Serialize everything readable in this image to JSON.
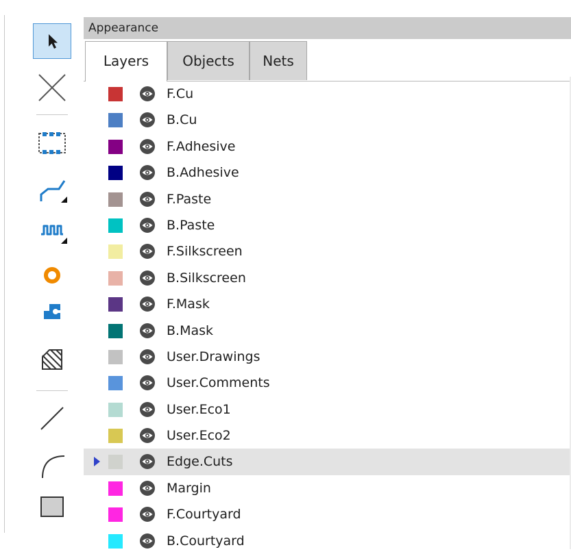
{
  "panel": {
    "title": "Appearance",
    "tabs": [
      {
        "label": "Layers",
        "active": true
      },
      {
        "label": "Objects",
        "active": false
      },
      {
        "label": "Nets",
        "active": false
      }
    ]
  },
  "toolbar": {
    "tools": [
      {
        "name": "select-tool",
        "icon": "cursor-arrow-icon",
        "active": true
      },
      {
        "name": "local-ratsnest-tool",
        "icon": "ratsnest-x-icon"
      },
      {
        "name": "add-footprint-tool",
        "icon": "footprint-chip-icon"
      },
      {
        "name": "route-track-tool",
        "icon": "route-track-icon",
        "submenu": true
      },
      {
        "name": "tune-length-tool",
        "icon": "meander-icon",
        "submenu": true
      },
      {
        "name": "add-via-tool",
        "icon": "via-ring-icon"
      },
      {
        "name": "add-pad-tool",
        "icon": "pad-icon"
      },
      {
        "name": "add-zone-tool",
        "icon": "zone-hatch-icon"
      },
      {
        "name": "draw-line-tool",
        "icon": "line-icon"
      },
      {
        "name": "draw-arc-tool",
        "icon": "arc-icon"
      },
      {
        "name": "draw-rectangle-tool",
        "icon": "rectangle-icon"
      }
    ]
  },
  "layers": [
    {
      "name": "F.Cu",
      "color": "#c83434"
    },
    {
      "name": "B.Cu",
      "color": "#4d7fc4"
    },
    {
      "name": "F.Adhesive",
      "color": "#840084"
    },
    {
      "name": "B.Adhesive",
      "color": "#000084"
    },
    {
      "name": "F.Paste",
      "color": "#a39391"
    },
    {
      "name": "B.Paste",
      "color": "#00c2c2"
    },
    {
      "name": "F.Silkscreen",
      "color": "#f2eda1"
    },
    {
      "name": "B.Silkscreen",
      "color": "#e8b2a7"
    },
    {
      "name": "F.Mask",
      "color": "#5b3685"
    },
    {
      "name": "B.Mask",
      "color": "#027474"
    },
    {
      "name": "User.Drawings",
      "color": "#c2c2c2"
    },
    {
      "name": "User.Comments",
      "color": "#5994dc"
    },
    {
      "name": "User.Eco1",
      "color": "#b4dbd2"
    },
    {
      "name": "User.Eco2",
      "color": "#d8c853"
    },
    {
      "name": "Edge.Cuts",
      "color": "#d0d2cd",
      "selected": true
    },
    {
      "name": "Margin",
      "color": "#ff26e2"
    },
    {
      "name": "F.Courtyard",
      "color": "#ff26e2"
    },
    {
      "name": "B.Courtyard",
      "color": "#26e9ff"
    }
  ]
}
